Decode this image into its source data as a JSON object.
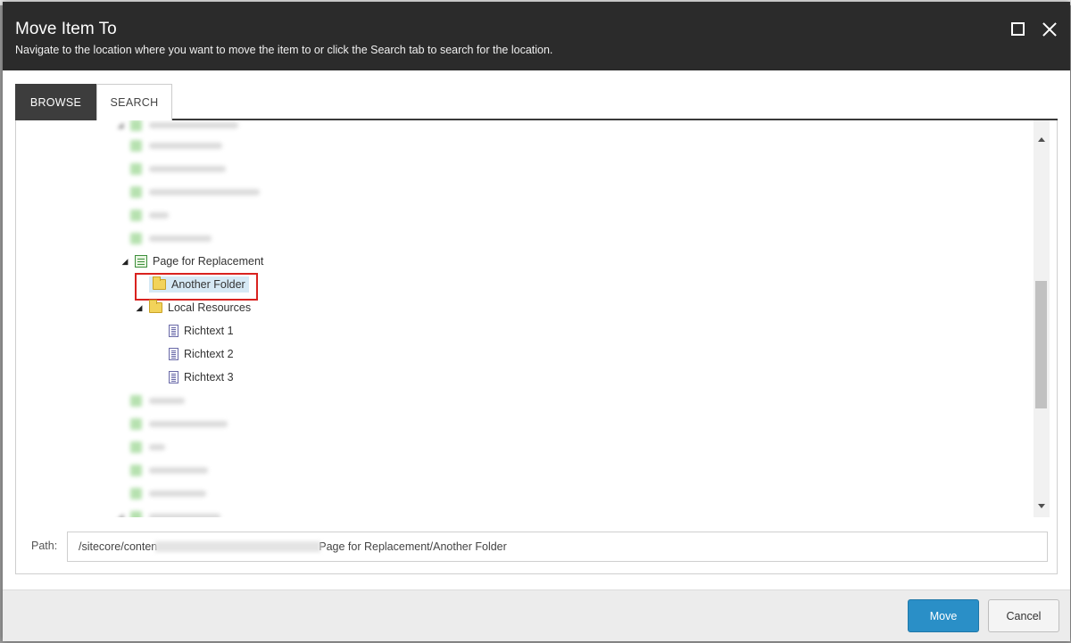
{
  "dialog": {
    "title": "Move Item To",
    "subtitle": "Navigate to the location where you want to move the item to or click the Search tab to search for the location."
  },
  "tabs": [
    {
      "label": "BROWSE",
      "active": true
    },
    {
      "label": "SEARCH",
      "active": false
    }
  ],
  "tree": {
    "page_for_replacement": "Page for Replacement",
    "another_folder": "Another Folder",
    "local_resources": "Local Resources",
    "richtext_1": "Richtext 1",
    "richtext_2": "Richtext 2",
    "richtext_3": "Richtext 3"
  },
  "path": {
    "label": "Path:",
    "prefix": "/sitecore/conten",
    "suffix": "Page for Replacement/Another Folder"
  },
  "buttons": {
    "move": "Move",
    "cancel": "Cancel"
  },
  "colors": {
    "header_bg": "#2b2b2b",
    "primary_button": "#2a8fc7",
    "selection_bg": "#d6e9f5",
    "highlight_border": "#d9221f"
  }
}
